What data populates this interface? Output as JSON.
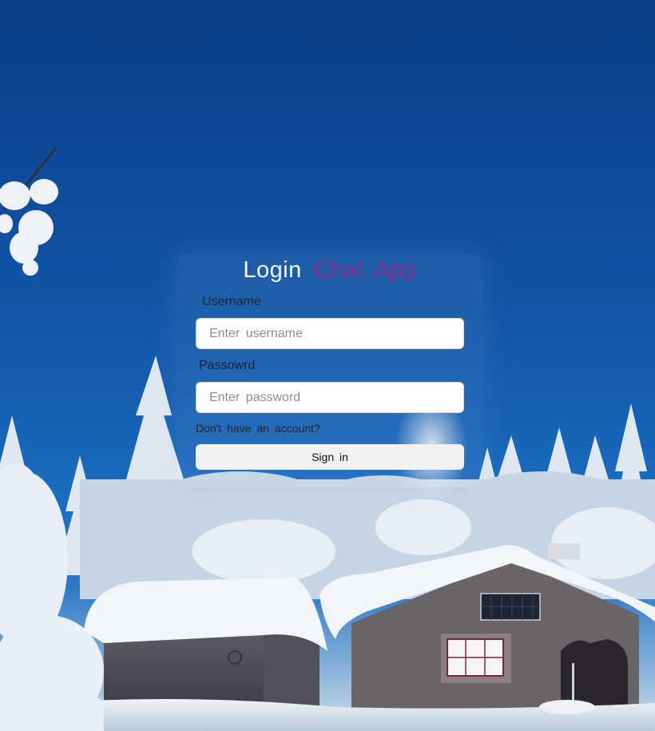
{
  "app": {
    "title_part1": "Login",
    "title_part2": "Chat App"
  },
  "form": {
    "username_label": "Username",
    "username_placeholder": "Enter username",
    "username_value": "",
    "password_label": "Passowrd",
    "password_placeholder": "Enter password",
    "password_value": "",
    "signup_link": "Don't have an account?",
    "signin_label": "Sign in"
  },
  "colors": {
    "title_primary": "#f4f6fa",
    "title_accent": "#8a2a8c",
    "sky": "#0f4e9e"
  }
}
